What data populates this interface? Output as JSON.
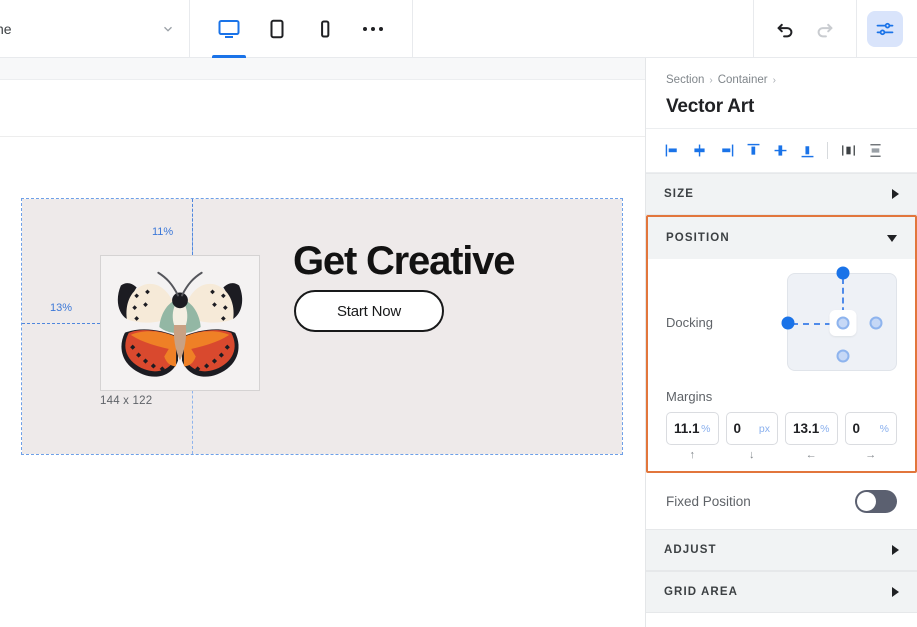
{
  "topbar": {
    "page_name": "ne",
    "page_select_icon": "chevron-down-icon",
    "devices": [
      {
        "id": "desktop",
        "icon": "desktop-icon",
        "active": true
      },
      {
        "id": "tablet",
        "icon": "tablet-icon",
        "active": false
      },
      {
        "id": "mobile",
        "icon": "mobile-icon",
        "active": false
      },
      {
        "id": "more",
        "icon": "more-horizontal-icon",
        "active": false
      }
    ],
    "undo_icon": "undo-icon",
    "redo_icon": "redo-icon",
    "panel_toggle_icon": "sliders-icon",
    "accent": "#1a73e8"
  },
  "canvas": {
    "headline": "Get Creative",
    "cta_label": "Start Now",
    "image_caption": "144 x 122",
    "guide_top_label": "11%",
    "guide_left_label": "13%",
    "section_bg": "#eeeaea",
    "selection_color": "#6ea0e8",
    "guide_color": "#3c78d8"
  },
  "panel": {
    "breadcrumb": {
      "items": [
        "Section",
        "Container"
      ],
      "separator": "›"
    },
    "title": "Vector Art",
    "align_tools": [
      {
        "name": "align-left-icon"
      },
      {
        "name": "align-center-horizontal-icon"
      },
      {
        "name": "align-right-icon"
      },
      {
        "name": "align-top-icon"
      },
      {
        "name": "align-center-vertical-icon"
      },
      {
        "name": "align-bottom-icon"
      },
      {
        "name": "distribute-horizontal-icon"
      },
      {
        "name": "distribute-vertical-icon"
      }
    ],
    "sections": {
      "size": {
        "title": "SIZE",
        "expanded": false
      },
      "position": {
        "title": "POSITION",
        "expanded": true,
        "highlight_color": "#e2763c"
      },
      "adjust": {
        "title": "ADJUST",
        "expanded": false
      },
      "grid_area": {
        "title": "GRID AREA",
        "expanded": false
      }
    },
    "position": {
      "docking_label": "Docking",
      "docking": {
        "top_active": true,
        "left_active": true,
        "center_active": false,
        "right_active": false,
        "bottom_active": false
      },
      "margins_label": "Margins",
      "margins": [
        {
          "value": "11.1",
          "unit": "%",
          "arrow": "↑",
          "side": "top"
        },
        {
          "value": "0",
          "unit": "px",
          "arrow": "↓",
          "side": "bottom"
        },
        {
          "value": "13.1",
          "unit": "%",
          "arrow": "←",
          "side": "left"
        },
        {
          "value": "0",
          "unit": "%",
          "arrow": "→",
          "side": "right"
        }
      ],
      "fixed_position_label": "Fixed Position",
      "fixed_position_on": false
    }
  }
}
